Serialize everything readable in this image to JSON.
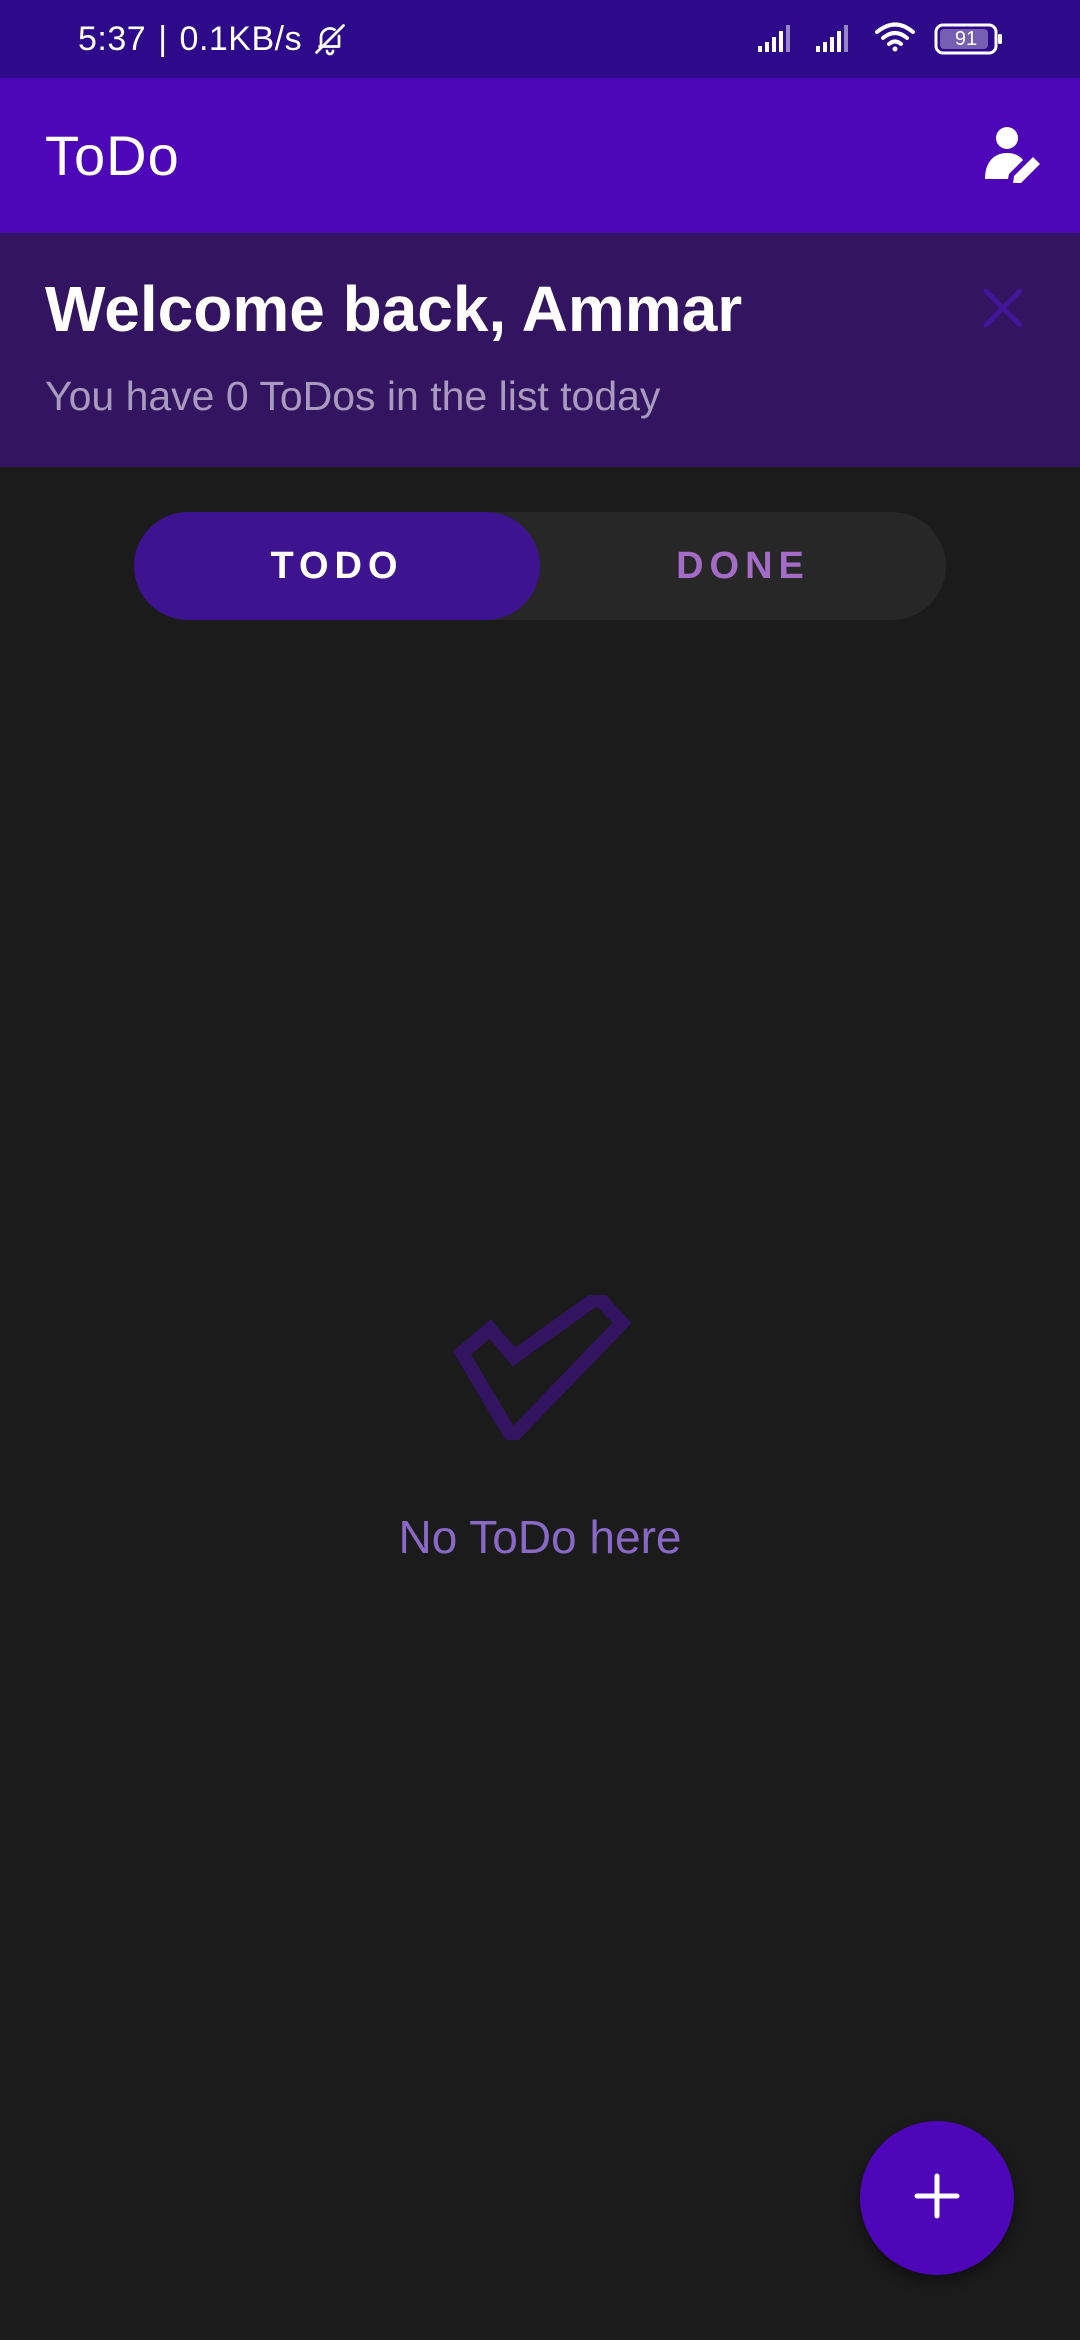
{
  "status_bar": {
    "time": "5:37",
    "separator": "|",
    "network_speed": "0.1KB/s",
    "battery_level": "91",
    "icons": [
      "bell-off-icon",
      "signal-icon",
      "signal-icon",
      "wifi-icon",
      "battery-icon"
    ]
  },
  "app_bar": {
    "title": "ToDo",
    "profile_icon": "user-edit-icon"
  },
  "welcome": {
    "title": "Welcome back, Ammar",
    "subtitle": "You have 0 ToDos in the list today",
    "dismiss_icon": "close-icon"
  },
  "tabs": [
    {
      "label": "TODO",
      "selected": true
    },
    {
      "label": "DONE",
      "selected": false
    }
  ],
  "empty_state": {
    "icon": "checkmark-icon",
    "message": "No ToDo here"
  },
  "fab": {
    "icon": "plus-icon"
  },
  "colors": {
    "status_bar": "#2c0a8a",
    "app_bar": "#4e06b9",
    "welcome_bg": "#331460",
    "background": "#1b1b1c",
    "tab_selected": "#3e1390",
    "tab_unselected_text": "#a56cc7",
    "empty_text": "#8a68c5"
  }
}
